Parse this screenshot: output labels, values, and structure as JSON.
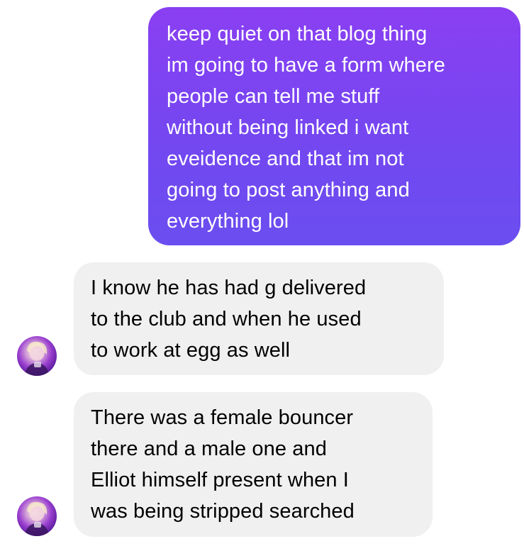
{
  "conversation": {
    "messages": [
      {
        "direction": "sent",
        "text": "keep quiet on that blog thing\nim going to have a form where\npeople can tell me stuff\nwithout being linked i want\neveidence and that im not\ngoing to post anything and\neverything lol"
      },
      {
        "direction": "received",
        "text": "I know he has had g delivered\nto the club and when he used\nto work at egg as well"
      },
      {
        "direction": "received",
        "text": "There was a female bouncer\nthere and a male one and\nElliot himself present when I\nwas being stripped searched"
      }
    ]
  },
  "colors": {
    "sent_bubble_top": "#8a3ff2",
    "sent_bubble_bottom": "#6a4ef0",
    "received_bubble": "#f0f0f0",
    "background": "#ffffff"
  },
  "icons": {
    "avatar": "contact-avatar-photo"
  }
}
